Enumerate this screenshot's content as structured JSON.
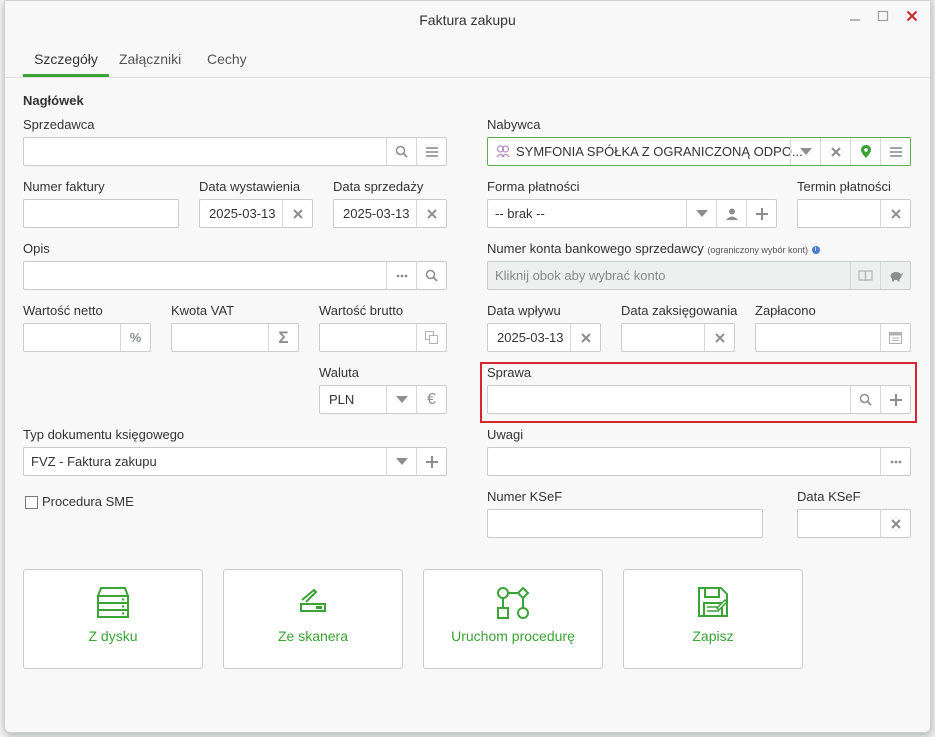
{
  "window": {
    "title": "Faktura zakupu"
  },
  "tabs": [
    {
      "label": "Szczegóły"
    },
    {
      "label": "Załączniki"
    },
    {
      "label": "Cechy"
    }
  ],
  "section": {
    "header": "Nagłówek"
  },
  "left": {
    "seller_label": "Sprzedawca",
    "invoice_number_label": "Numer faktury",
    "issue_date_label": "Data wystawienia",
    "issue_date_value": "2025-03-13",
    "sale_date_label": "Data sprzedaży",
    "sale_date_value": "2025-03-13",
    "description_label": "Opis",
    "net_label": "Wartość netto",
    "vat_label": "Kwota VAT",
    "gross_label": "Wartość brutto",
    "currency_label": "Waluta",
    "currency_value": "PLN",
    "doc_type_label": "Typ dokumentu księgowego",
    "doc_type_value": "FVZ - Faktura zakupu",
    "sme_label": "Procedura SME"
  },
  "right": {
    "buyer_label": "Nabywca",
    "buyer_value": "SYMFONIA SPÓŁKA Z OGRANICZONĄ ODPO...",
    "payment_form_label": "Forma płatności",
    "payment_form_value": "-- brak --",
    "payment_term_label": "Termin płatności",
    "bank_label": "Numer konta bankowego sprzedawcy",
    "bank_note": "(ograniczony wybór kont)",
    "bank_placeholder": "Kliknij obok aby wybrać konto",
    "receipt_date_label": "Data wpływu",
    "receipt_date_value": "2025-03-13",
    "posting_date_label": "Data zaksięgowania",
    "paid_label": "Zapłacono",
    "case_label": "Sprawa",
    "notes_label": "Uwagi",
    "ksef_number_label": "Numer KSeF",
    "ksef_date_label": "Data KSeF"
  },
  "actions": [
    {
      "label": "Z dysku",
      "icon": "drive-icon"
    },
    {
      "label": "Ze skanera",
      "icon": "scanner-icon"
    },
    {
      "label": "Uruchom procedurę",
      "icon": "flowchart-icon"
    },
    {
      "label": "Zapisz",
      "icon": "save-icon"
    }
  ],
  "colors": {
    "accent": "#3aa335",
    "highlight": "#d62730"
  }
}
